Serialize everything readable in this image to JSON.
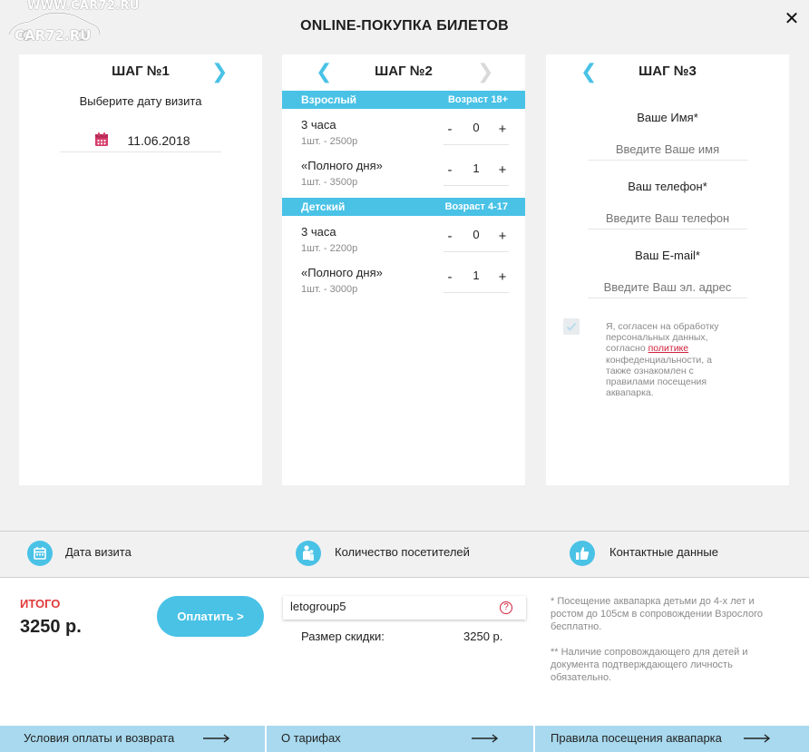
{
  "watermark": {
    "line1": "WWW.CAR72.RU",
    "line2": "CAR72.RU"
  },
  "title": "ONLINE-ПОКУПКА БИЛЕТОВ",
  "close_icon": "close-icon",
  "step1": {
    "title": "ШАГ №1",
    "subtitle": "Выберите дату визита",
    "date": "11.06.2018"
  },
  "step2": {
    "title": "ШАГ №2",
    "categories": [
      {
        "name": "Взрослый",
        "age": "Возраст 18+",
        "tickets": [
          {
            "name": "3 часа",
            "price": "1шт. - 2500р",
            "qty": "0"
          },
          {
            "name": "«Полного дня»",
            "price": "1шт. - 3500р",
            "qty": "1"
          }
        ]
      },
      {
        "name": "Детский",
        "age": "Возраст 4-17",
        "tickets": [
          {
            "name": "3 часа",
            "price": "1шт. - 2200р",
            "qty": "0"
          },
          {
            "name": "«Полного дня»",
            "price": "1шт. - 3000р",
            "qty": "1"
          }
        ]
      }
    ],
    "minus": "-",
    "plus": "+"
  },
  "step3": {
    "title": "ШАГ №3",
    "name_label": "Ваше Имя*",
    "name_placeholder": "Введите Ваше имя",
    "phone_label": "Ваш телефон*",
    "phone_placeholder": "Введите Ваш телефон",
    "email_label": "Ваш E-mail*",
    "email_placeholder": "Введите Ваш эл. адрес",
    "consent_before": "Я, согласен на обработку персональных данных, согласно ",
    "consent_link": "политике",
    "consent_after": " конфеденциальности, а также ознакомлен с правилами посещения аквапарка.",
    "consent_checked": true
  },
  "summary": {
    "date": "Дата визита",
    "visitors": "Количество посетителей",
    "contacts": "Контактные данные"
  },
  "total": {
    "label": "ИТОГО",
    "value": "3250 р.",
    "pay_button": "Оплатить >"
  },
  "promo": {
    "code": "letogroup5",
    "help": "?",
    "discount_label": "Размер скидки:",
    "discount_value": "3250 р."
  },
  "notes": {
    "note1": "* Посещение аквапарка детьми до 4-х лет и ростом до 105см в сопровождении Взрослого бесплатно.",
    "note2": "** Наличие сопровождающего для детей и документа подтверждающего личность обязательно."
  },
  "footer": {
    "links": [
      "Условия оплаты и возврата",
      "О тарифах",
      "Правила посещения аквапарка"
    ]
  },
  "colors": {
    "accent": "#49c2e6",
    "danger": "#e03a3a",
    "link": "#d2213b",
    "footer": "#a8d9ee"
  }
}
